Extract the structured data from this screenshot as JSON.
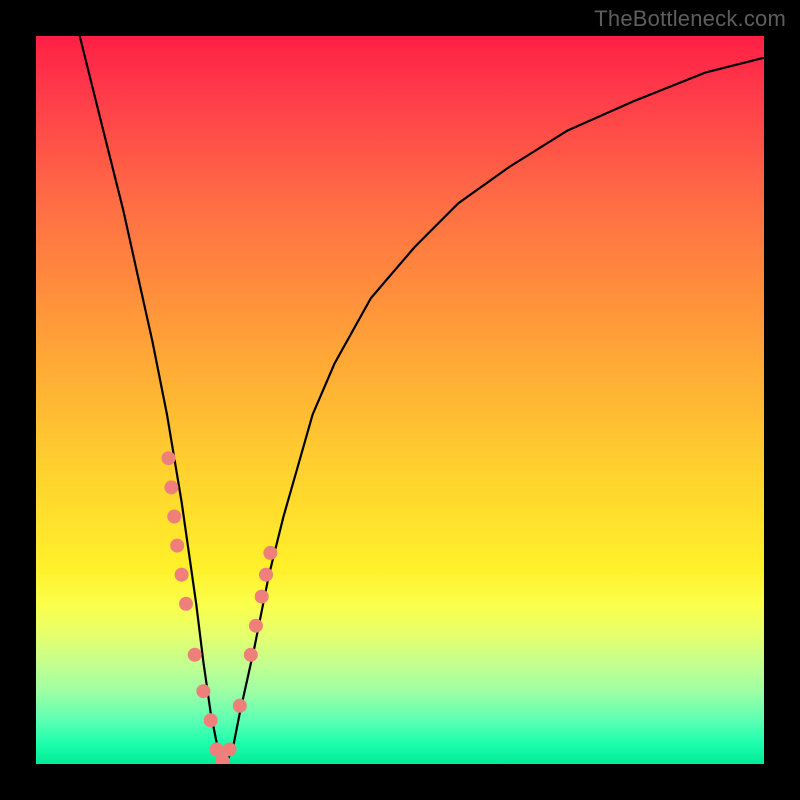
{
  "watermark": "TheBottleneck.com",
  "chart_data": {
    "type": "line",
    "title": "",
    "xlabel": "",
    "ylabel": "",
    "xlim": [
      0,
      100
    ],
    "ylim": [
      0,
      100
    ],
    "grid": false,
    "legend": false,
    "series": [
      {
        "name": "curve",
        "stroke": "#000000",
        "x": [
          6,
          9,
          12,
          14,
          16,
          18,
          19,
          20,
          21,
          22,
          23,
          24,
          25,
          26,
          27,
          28,
          30,
          32,
          34,
          36,
          38,
          41,
          46,
          52,
          58,
          65,
          73,
          82,
          92,
          100
        ],
        "y": [
          100,
          88,
          76,
          67,
          58,
          48,
          42,
          36,
          29,
          22,
          14,
          7,
          2,
          0,
          2,
          7,
          16,
          26,
          34,
          41,
          48,
          55,
          64,
          71,
          77,
          82,
          87,
          91,
          95,
          97
        ]
      }
    ],
    "markers": {
      "name": "dots",
      "color": "#ee7f7a",
      "radius_px": 7,
      "points": [
        {
          "x": 18.2,
          "y": 42
        },
        {
          "x": 18.6,
          "y": 38
        },
        {
          "x": 19.0,
          "y": 34
        },
        {
          "x": 19.4,
          "y": 30
        },
        {
          "x": 20.0,
          "y": 26
        },
        {
          "x": 20.6,
          "y": 22
        },
        {
          "x": 21.8,
          "y": 15
        },
        {
          "x": 23.0,
          "y": 10
        },
        {
          "x": 24.0,
          "y": 6
        },
        {
          "x": 24.8,
          "y": 2
        },
        {
          "x": 25.6,
          "y": 0.5
        },
        {
          "x": 26.6,
          "y": 2
        },
        {
          "x": 28.0,
          "y": 8
        },
        {
          "x": 29.5,
          "y": 15
        },
        {
          "x": 30.2,
          "y": 19
        },
        {
          "x": 31.0,
          "y": 23
        },
        {
          "x": 31.6,
          "y": 26
        },
        {
          "x": 32.2,
          "y": 29
        }
      ]
    },
    "background": {
      "type": "vertical-gradient",
      "stops": [
        {
          "pos": 0.0,
          "color": "#ff1f44"
        },
        {
          "pos": 0.5,
          "color": "#ffb234"
        },
        {
          "pos": 0.78,
          "color": "#fbff4a"
        },
        {
          "pos": 1.0,
          "color": "#00ec97"
        }
      ]
    }
  }
}
